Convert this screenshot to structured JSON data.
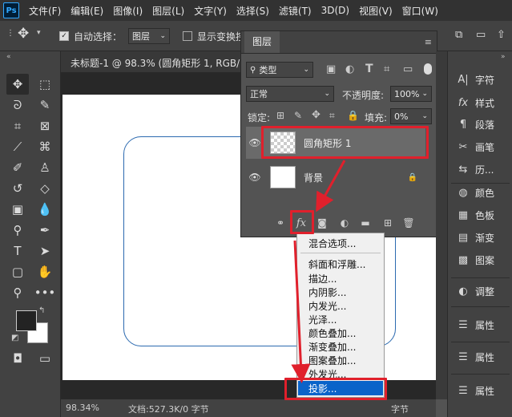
{
  "app": {
    "logo": "Ps"
  },
  "menu": [
    "文件(F)",
    "编辑(E)",
    "图像(I)",
    "图层(L)",
    "文字(Y)",
    "选择(S)",
    "滤镜(T)",
    "3D(D)",
    "视图(V)",
    "窗口(W)"
  ],
  "options": {
    "auto_select_label": "自动选择：",
    "auto_select_value": "图层",
    "show_transform_label": "显示变换控"
  },
  "document": {
    "tab_title": "未标题-1 @ 98.3% (圆角矩形 1, RGB/8) *"
  },
  "status": {
    "zoom": "98.34%",
    "doc_info": "文档:527.3K/0 字节",
    "right": "字节"
  },
  "layers_panel": {
    "tab": "图层",
    "filter": "类型",
    "blend_mode": "正常",
    "opacity_label": "不透明度:",
    "opacity_value": "100%",
    "lock_label": "锁定:",
    "fill_label": "填充:",
    "fill_value": "0%",
    "layers": [
      {
        "name": "圆角矩形 1",
        "selected": true
      },
      {
        "name": "背景",
        "locked": true
      }
    ]
  },
  "fx_menu": {
    "items": [
      "混合选项...",
      "斜面和浮雕...",
      "描边...",
      "内阴影...",
      "内发光...",
      "光泽...",
      "颜色叠加...",
      "渐变叠加...",
      "图案叠加...",
      "外发光...",
      "投影..."
    ],
    "highlighted": "投影..."
  },
  "right_panel": [
    {
      "label": "字符",
      "icon": "character-icon"
    },
    {
      "label": "样式",
      "icon": "fx-style-icon"
    },
    {
      "label": "段落",
      "icon": "paragraph-icon"
    },
    {
      "label": "画笔",
      "icon": "brush-settings-icon"
    },
    {
      "label": "历...",
      "icon": "history-icon"
    },
    {
      "label": "颜色",
      "icon": "color-palette-icon"
    },
    {
      "label": "色板",
      "icon": "swatches-icon"
    },
    {
      "label": "渐变",
      "icon": "gradient-icon"
    },
    {
      "label": "图案",
      "icon": "pattern-icon"
    },
    {
      "label": "调整",
      "icon": "adjustments-icon"
    },
    {
      "label": "属性",
      "icon": "properties-icon"
    },
    {
      "label": "属性",
      "icon": "properties-icon"
    },
    {
      "label": "属性",
      "icon": "properties-icon"
    }
  ],
  "colors": {
    "accent_red": "#e0202c",
    "highlight_blue": "#0a63c9",
    "rect_stroke": "#2c6ab0"
  }
}
